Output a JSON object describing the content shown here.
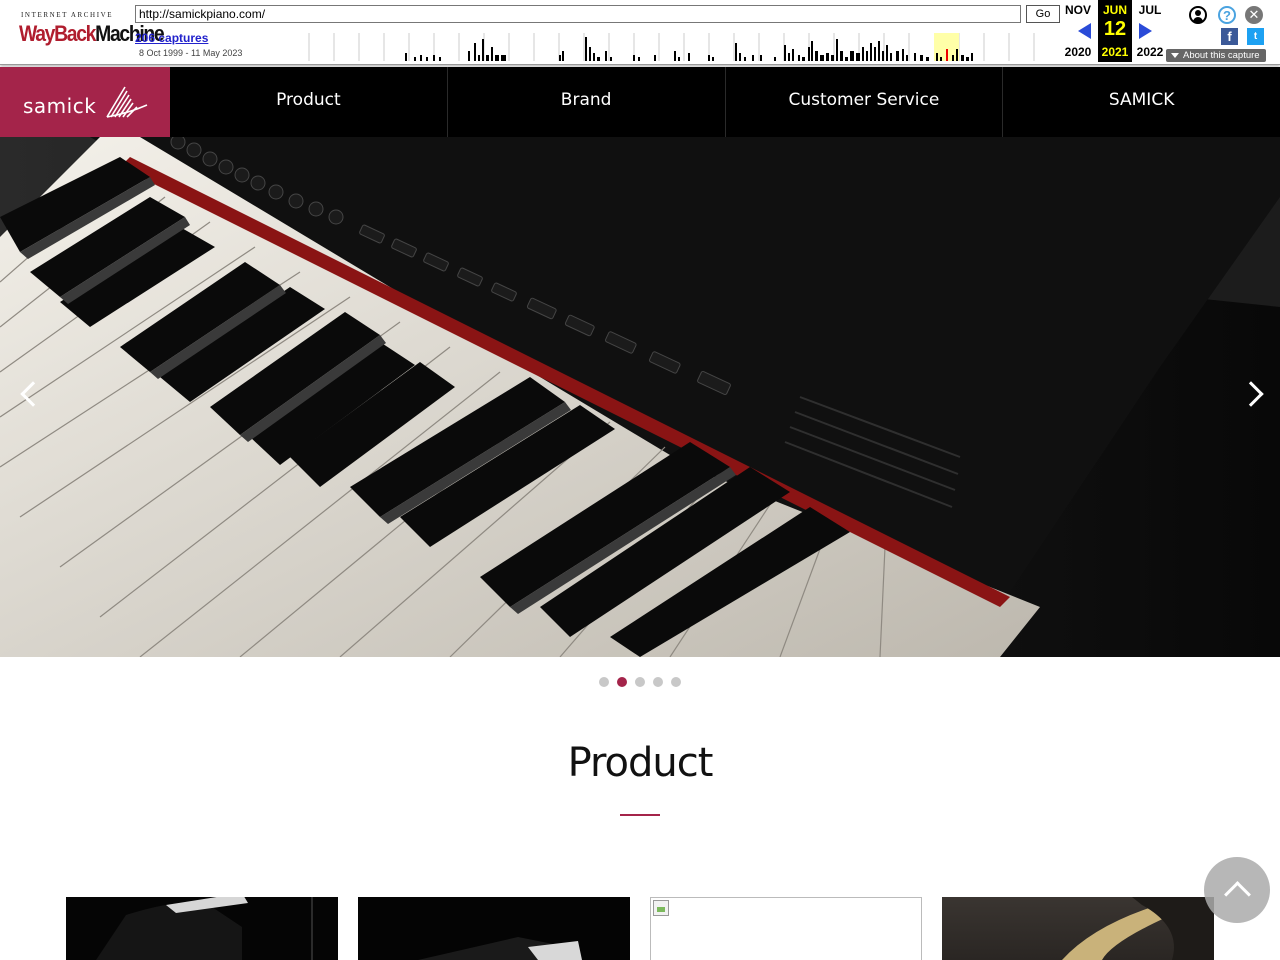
{
  "wayback": {
    "logo_top": "INTERNET ARCHIVE",
    "logo_word_1": "WayBack",
    "logo_word_2": "Machine",
    "url": "http://samickpiano.com/",
    "go_label": "Go",
    "captures": "206 captures",
    "date_range": "8 Oct 1999 - 11 May 2023",
    "prev_month": "NOV",
    "prev_year": "2020",
    "current_month": "JUN",
    "current_day": "12",
    "current_year": "2021",
    "next_month": "JUL",
    "next_year": "2022",
    "help_glyph": "?",
    "close_glyph": "✕",
    "facebook_glyph": "f",
    "twitter_glyph": "t",
    "about_label": "About this capture",
    "icons": [
      "user-icon",
      "help-icon",
      "close-icon",
      "facebook-icon",
      "twitter-icon",
      "prev-arrow-icon",
      "next-arrow-icon"
    ]
  },
  "site": {
    "brand_name": "samick",
    "brand_color": "#a4244a",
    "nav": [
      "Product",
      "Brand",
      "Customer Service",
      "SAMICK"
    ],
    "slider": {
      "total_slides": 5,
      "active_slide": 2
    },
    "section_title": "Product"
  }
}
